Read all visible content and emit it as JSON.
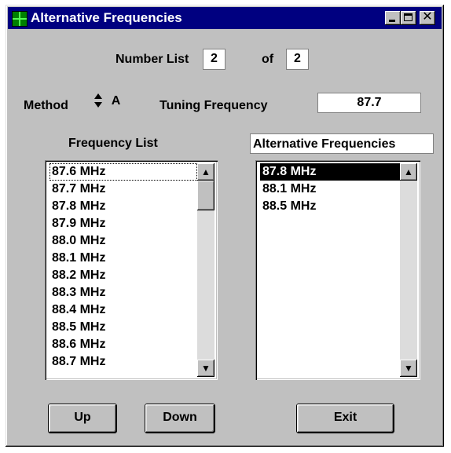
{
  "window": {
    "title": "Alternative Frequencies",
    "close_glyph": "✕"
  },
  "number_list": {
    "label": "Number List",
    "value": "2",
    "of_label": "of",
    "total": "2"
  },
  "method": {
    "label": "Method",
    "value": "A"
  },
  "tuning": {
    "label": "Tuning Frequency",
    "value": "87.7"
  },
  "frequency_list": {
    "header": "Frequency List",
    "items": [
      "87.6 MHz",
      "87.7 MHz",
      "87.8 MHz",
      "87.9 MHz",
      "88.0 MHz",
      "88.1 MHz",
      "88.2 MHz",
      "88.3 MHz",
      "88.4 MHz",
      "88.5 MHz",
      "88.6 MHz",
      "88.7 MHz"
    ]
  },
  "alternative_list": {
    "header": "Alternative Frequencies",
    "items": [
      "87.8 MHz",
      "88.1 MHz",
      "88.5 MHz"
    ]
  },
  "scroll": {
    "up_glyph": "▲",
    "down_glyph": "▼"
  },
  "buttons": {
    "up": "Up",
    "down": "Down",
    "exit": "Exit"
  },
  "colors": {
    "titlebar": "#000080",
    "face": "#c0c0c0",
    "selection": "#000000"
  }
}
